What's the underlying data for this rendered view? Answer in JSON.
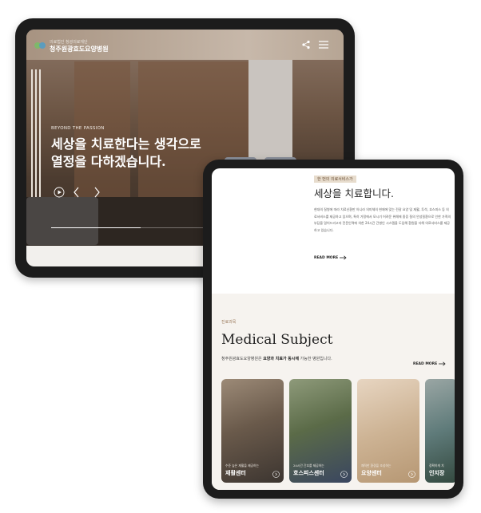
{
  "hero_tablet": {
    "logo": {
      "small": "의료법인 청광의료재단",
      "name": "청주원광효도요양병원"
    },
    "eyebrow": "BEYOND THE PASSION",
    "headline_line1": "세상을 치료한다는 생각으로",
    "headline_line2": "열정을 다하겠습니다.",
    "icons": {
      "share": "share-icon",
      "menu": "hamburger-menu-icon",
      "play": "play-icon",
      "prev": "chevron-left-icon",
      "next": "chevron-right-icon"
    },
    "slide_progress": 0.36
  },
  "content_tablet": {
    "service": {
      "badge": "한 번의 의료서비스가",
      "title": "세상을 치료합니다.",
      "description": "현대의 질병에 따라 치료신환만 아니라 의미체의 현재에 맞는 전갈 요양 및 재활, 투석, 호스피스 등 의료서비스를 제공하고 있으며, 특히 가정에서 모시기 어려운 위해에 중증 질의 안성질환으로 인한 가족의 부담을 덜어드리고자 전문인력에 의한 24시간 간병인 시스템을 도입해 환원을 더해 의료서비스를 제공하고 있습니다.",
      "read_more": "READ MORE"
    },
    "medical": {
      "category": "진료과목",
      "title": "Medical Subject",
      "intro_prefix": "청주원광효도요양병원은 ",
      "intro_bold": "요양과 치료가 동시에",
      "intro_suffix": " 가능한 병원입니다.",
      "read_more": "READ MORE",
      "cards": [
        {
          "caption": "수준 높은 재활을 제공하는",
          "name": "재활센터"
        },
        {
          "caption": "24시간 간호를 제공하는",
          "name": "호스피스센터"
        },
        {
          "caption": "쾌적한 환경을 조성하는",
          "name": "요양센터"
        },
        {
          "caption": "정확하게 치",
          "name": "인지장"
        }
      ]
    }
  },
  "colors": {
    "accent": "#9b7b5c",
    "badge_bg": "#e7dccd",
    "section_bg": "#f6f3ef",
    "bezel": "#1c1c1c"
  }
}
